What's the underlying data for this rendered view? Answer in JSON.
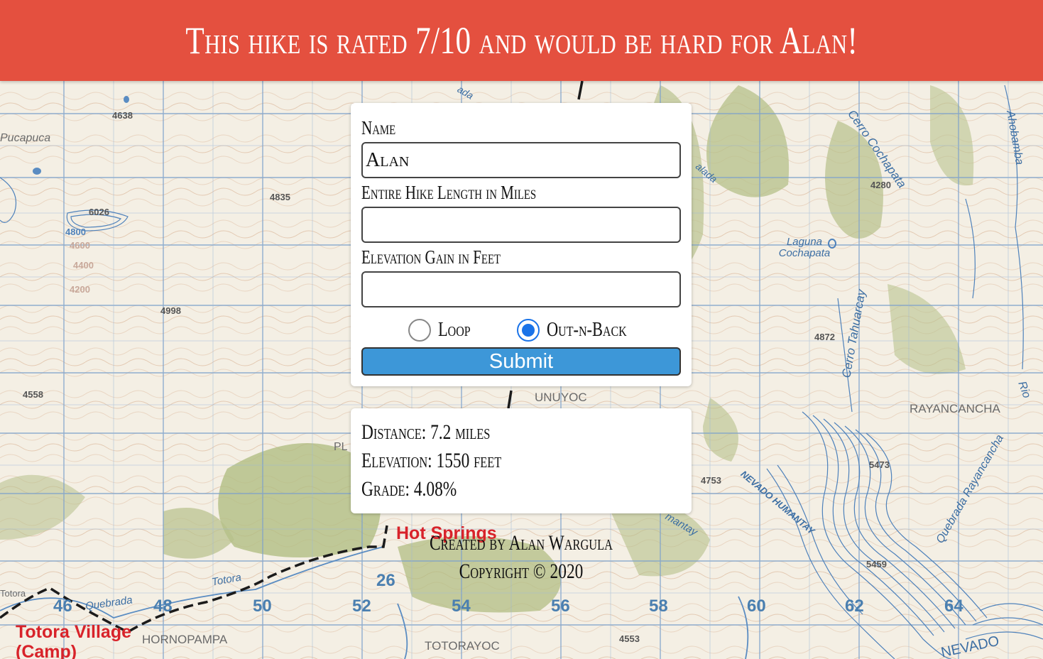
{
  "header": {
    "title": "This hike is rated 7/10 and would be hard for Alan!"
  },
  "form": {
    "name_label": "Name",
    "name_value": "Alan",
    "length_label": "Entire Hike Length in Miles",
    "length_value": "",
    "elevation_label": "Elevation Gain in Feet",
    "elevation_value": "",
    "radio_options": [
      {
        "label": "Loop",
        "checked": false
      },
      {
        "label": "Out-n-Back",
        "checked": true
      }
    ],
    "submit_label": "Submit",
    "submit_color": "#3d97d8"
  },
  "results": {
    "distance": "Distance: 7.2 miles",
    "elevation": "Elevation: 1550 feet",
    "grade": "Grade: 4.08%"
  },
  "footer": {
    "created_by": "Created by Alan Wargula",
    "copyright": "Copyright © 2020"
  },
  "map": {
    "grid_labels": [
      "46",
      "48",
      "50",
      "52",
      "54",
      "56",
      "58",
      "60",
      "62",
      "64"
    ],
    "grid_row_label": "26",
    "elevation_labels": [
      "4638",
      "4835",
      "6026",
      "4800",
      "4998",
      "4558",
      "4280",
      "4872",
      "4753",
      "5473",
      "5459",
      "4553",
      "4600",
      "4400",
      "4200"
    ],
    "place_labels": [
      "Pucapuca",
      "UNUYOC",
      "RAYANCANCHA",
      "HORNOPAMPA",
      "TOTORAYOC",
      "Totora",
      "NEVADO",
      "PL"
    ],
    "water_labels": [
      "Cerro Cochapata",
      "Laguna Cochapata",
      "Cerro Tahuarcay",
      "Quebrada Rayancancha",
      "Ahobamba",
      "Quebrada",
      "Totora",
      "Rio",
      "NEVADO HUMANTAY",
      "mantay",
      "alada",
      "ada"
    ],
    "red_labels": [
      "Hot Springs",
      "Totora Village",
      "(Camp)"
    ],
    "header_color": "#e4503f"
  }
}
